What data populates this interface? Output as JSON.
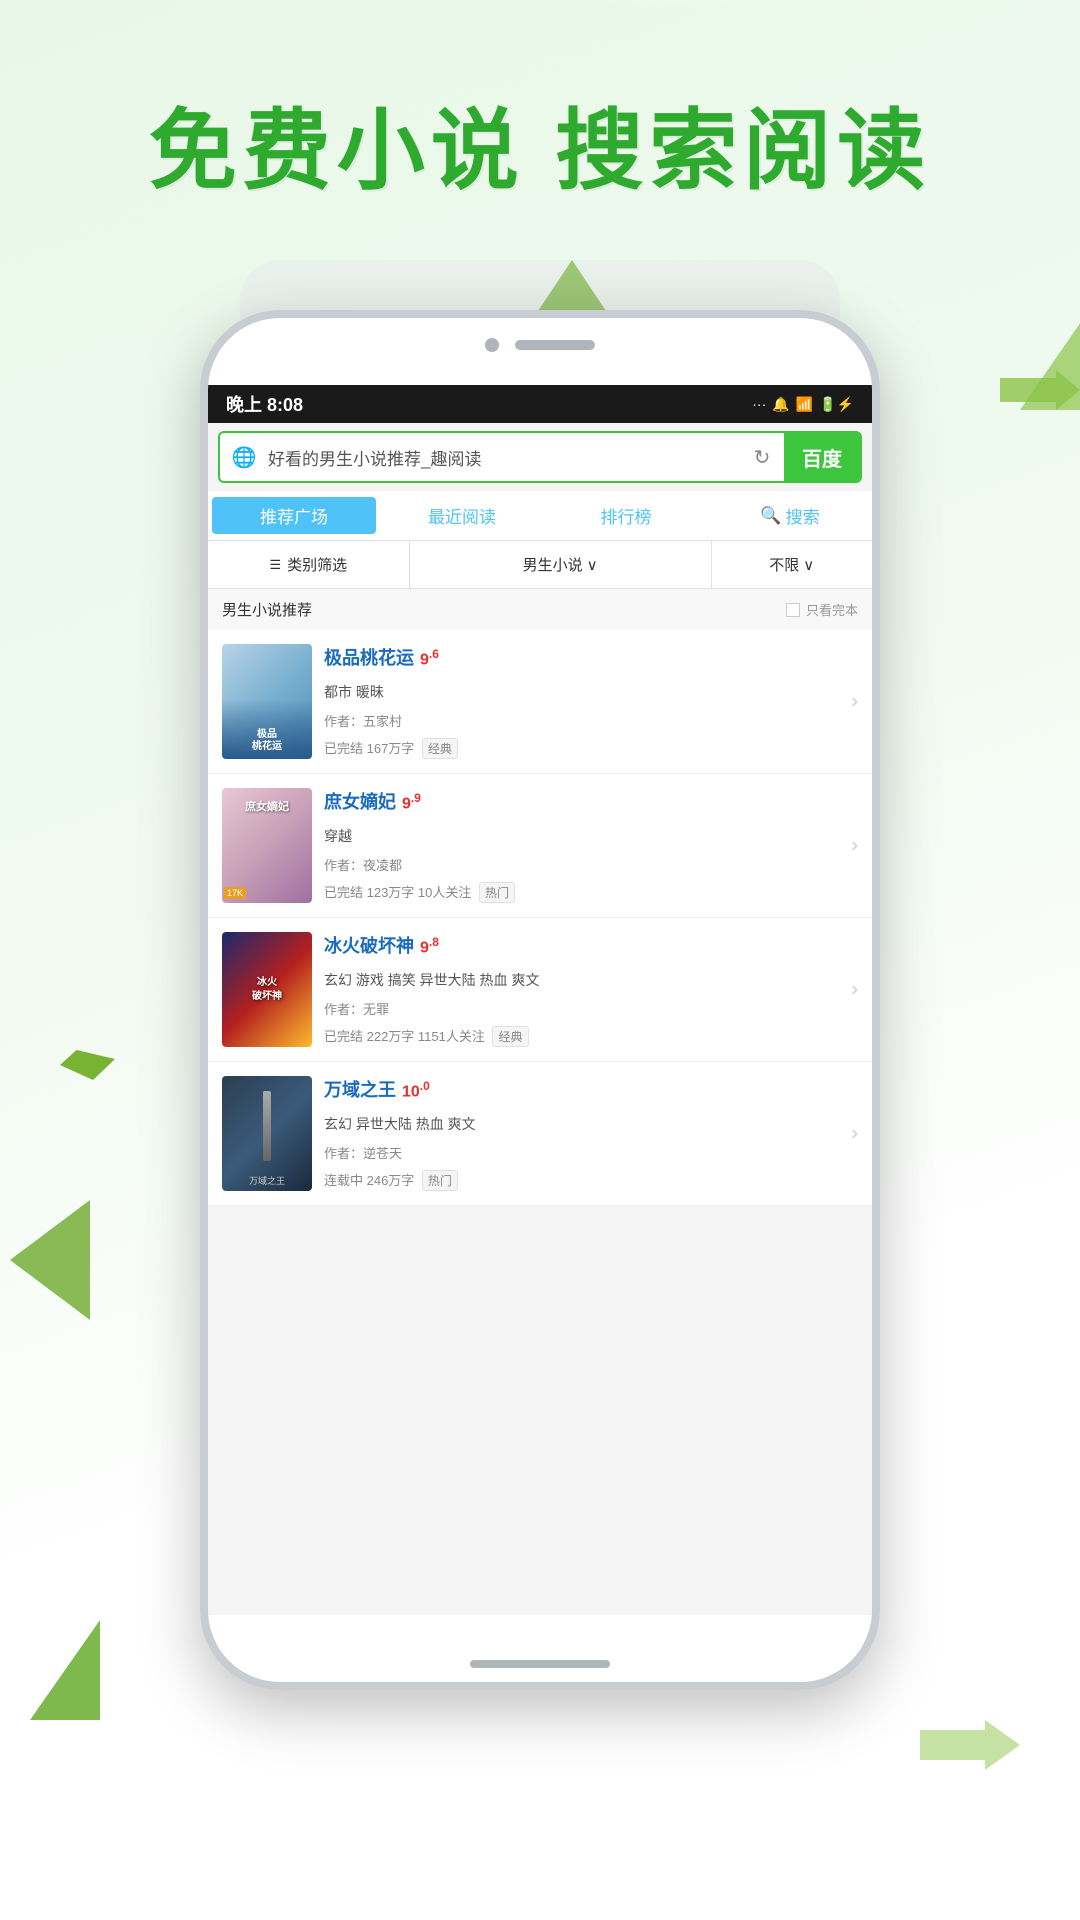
{
  "page": {
    "background": "#e8f8e0"
  },
  "header": {
    "title": "免费小说  搜索阅读"
  },
  "status_bar": {
    "time": "晚上 8:08",
    "signal": "···",
    "bell": "🔔",
    "wifi": "WiFi",
    "battery": "⚡"
  },
  "search": {
    "query": "好看的男生小说推荐_趣阅读",
    "baidu_label": "百度",
    "globe_icon": "🌐",
    "refresh_icon": "↻"
  },
  "nav_tabs": [
    {
      "label": "推荐广场",
      "active": true
    },
    {
      "label": "最近阅读",
      "active": false
    },
    {
      "label": "排行榜",
      "active": false
    },
    {
      "label": "搜索",
      "active": false,
      "has_icon": true
    }
  ],
  "filter": {
    "category_label": "类别筛选",
    "type_label": "男生小说",
    "limit_label": "不限",
    "chevron": "∨"
  },
  "section": {
    "title": "男生小说推荐",
    "complete_label": "只看完本"
  },
  "books": [
    {
      "title": "极品桃花运",
      "rating": "9",
      "rating_decimal": "6",
      "tags": "都市 暖昧",
      "author": "作者：五家村",
      "meta": "已完结 167万字  [经典]",
      "cover_type": "1",
      "cover_text": "极品\n桃花运"
    },
    {
      "title": "庶女嫡妃",
      "rating": "9",
      "rating_decimal": "9",
      "tags": "穿越",
      "author": "作者：夜凌都",
      "meta": "已完结 123万字 10人关注  [热门]",
      "cover_type": "2",
      "cover_text": "庶女嫡妃",
      "cover_badge": "17K"
    },
    {
      "title": "冰火破坏神",
      "rating": "9",
      "rating_decimal": "8",
      "tags": "玄幻 游戏 搞笑 异世大陆 热血 爽文",
      "author": "作者：无罪",
      "meta": "已完结 222万字 1151人关注  [经典]",
      "cover_type": "3",
      "cover_text": "冰火破坏神"
    },
    {
      "title": "万域之王",
      "rating": "10",
      "rating_decimal": "0",
      "tags": "玄幻 异世大陆 热血 爽文",
      "author": "作者：逆苍天",
      "meta": "连载中 246万字  [热门]",
      "cover_type": "4",
      "cover_text": "万域之王"
    }
  ]
}
